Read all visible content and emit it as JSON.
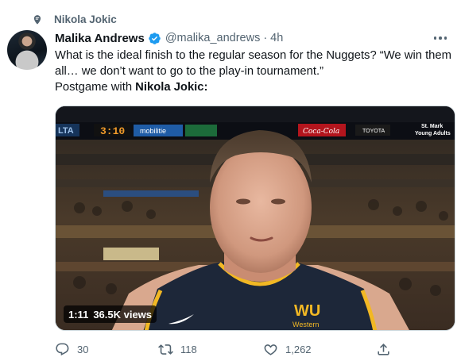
{
  "context": {
    "label": "Nikola Jokic",
    "icon": "topic-icon"
  },
  "tweet": {
    "author_name": "Malika Andrews",
    "handle": "@malika_andrews",
    "separator": "·",
    "time": "4h",
    "verified_icon": "verified-badge-icon",
    "text_line1": "What is the ideal finish to the regular season for the Nuggets? “We win them",
    "text_line2": "all… we don’t want to go to the play-in tournament.”",
    "text_line3_prefix": "Postgame with ",
    "text_line3_bold": "Nikola Jokic:"
  },
  "media": {
    "type": "video",
    "duration": "1:11",
    "views": "36.5K views",
    "scoreboard_left": "LTA",
    "scoreboard_clock": "3:10",
    "sponsor_mobility": "mobilitie",
    "sponsor_coke": "Coca-Cola",
    "sponsor_toyota": "TOYOTA",
    "sponsor_stmark_line1": "St. Mark",
    "sponsor_stmark_line2": "Young Adults",
    "jersey_text_line1": "WU",
    "jersey_text_line2": "Western",
    "accent_gold": "#f2b824",
    "jersey_navy": "#1d2739"
  },
  "actions": {
    "reply_count": "30",
    "retweet_count": "118",
    "like_count": "1,262"
  },
  "colors": {
    "text_primary": "#0f1419",
    "text_secondary": "#536471",
    "verified_blue": "#1d9bf0"
  }
}
